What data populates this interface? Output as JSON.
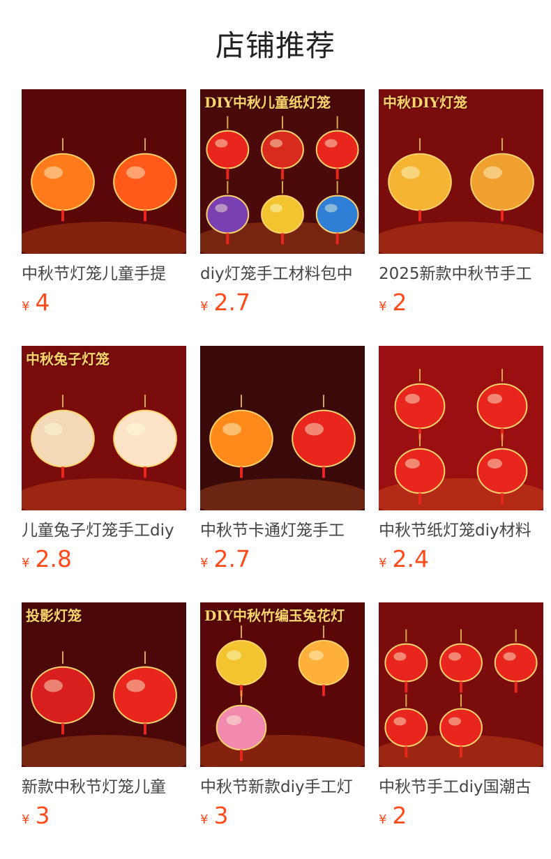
{
  "page_title": "店铺推荐",
  "colors": {
    "price": "#ff4a1a",
    "title": "#222222",
    "name": "#444444"
  },
  "currency": "¥",
  "products": [
    {
      "name": "中秋节灯笼儿童手提",
      "price": "4",
      "image_text": "",
      "bg": "#5a0707",
      "lanterns": [
        "#ff7a1a",
        "#ff5a1a"
      ]
    },
    {
      "name": "diy灯笼手工材料包中",
      "price": "2.7",
      "image_text": "DIY中秋儿童纸灯笼",
      "bg": "#4a0a0a",
      "lanterns": [
        "#e8261e",
        "#d92a1e",
        "#e8261e",
        "#7a3fb0",
        "#f2c530",
        "#2f7fd6"
      ]
    },
    {
      "name": "2025新款中秋节手工",
      "price": "2",
      "image_text": "中秋DIY灯笼",
      "bg": "#7a0c0c",
      "lanterns": [
        "#f5b431",
        "#f0a030"
      ]
    },
    {
      "name": "儿童兔子灯笼手工diy",
      "price": "2.8",
      "image_text": "中秋兔子灯笼",
      "bg": "#7a0c0c",
      "lanterns": [
        "#f3d9b5",
        "#fbe4c8"
      ]
    },
    {
      "name": "中秋节卡通灯笼手工",
      "price": "2.7",
      "image_text": "",
      "bg": "#3a0a0a",
      "lanterns": [
        "#ff8a1a",
        "#e8261e"
      ]
    },
    {
      "name": "中秋节纸灯笼diy材料",
      "price": "2.4",
      "image_text": "",
      "bg": "#9a1010",
      "lanterns": [
        "#e8261e",
        "#e8261e",
        "#e8261e",
        "#e8261e"
      ]
    },
    {
      "name": "新款中秋节灯笼儿童",
      "price": "3",
      "image_text": "投影灯笼",
      "bg": "#4a0808",
      "lanterns": [
        "#d91e1e",
        "#e8261e"
      ]
    },
    {
      "name": "中秋节新款diy手工灯",
      "price": "3",
      "image_text": "DIY中秋竹编玉兔花灯",
      "bg": "#5a0707",
      "lanterns": [
        "#f2c530",
        "#ffb03a",
        "#f28ab0"
      ]
    },
    {
      "name": "中秋节手工diy国潮古",
      "price": "2",
      "image_text": "",
      "bg": "#7a0c0c",
      "lanterns": [
        "#e8261e",
        "#e8261e",
        "#e8261e",
        "#e8261e",
        "#e8261e"
      ]
    }
  ]
}
